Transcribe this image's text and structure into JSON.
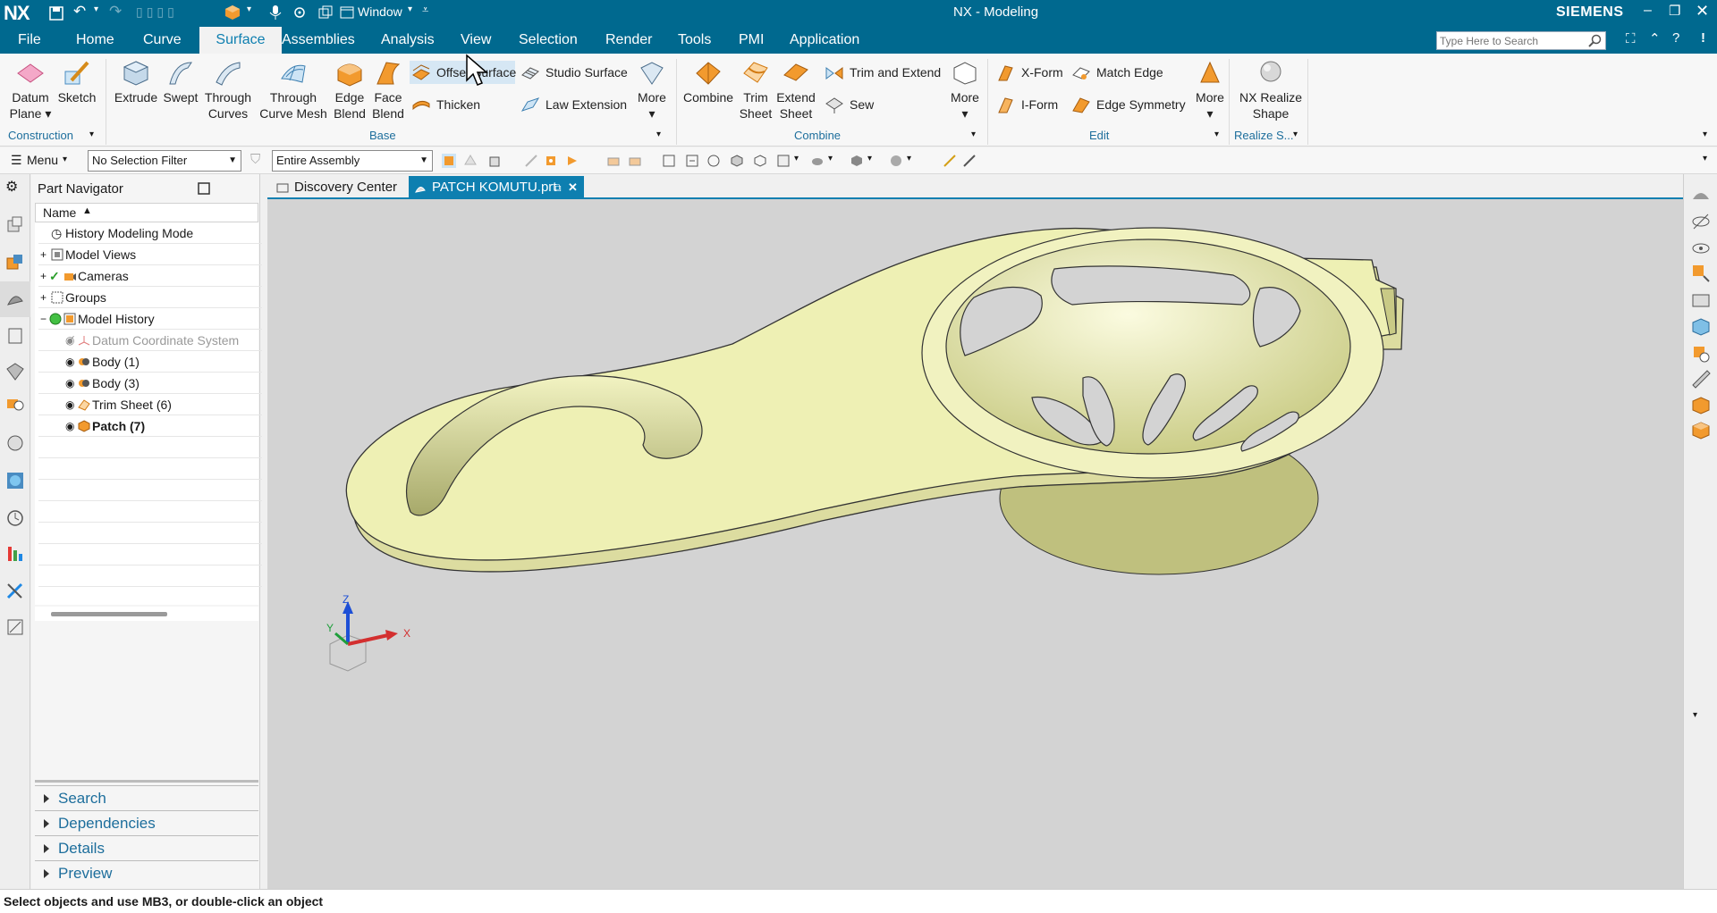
{
  "app": {
    "logo": "NX",
    "window_menu": "Window",
    "title": "NX - Modeling",
    "brand": "SIEMENS"
  },
  "menubar": {
    "items": [
      "File",
      "Home",
      "Curve",
      "Surface",
      "Assemblies",
      "Analysis",
      "View",
      "Selection",
      "Render",
      "Tools",
      "PMI",
      "Application"
    ],
    "active": "Surface",
    "search_placeholder": "Type Here to Search"
  },
  "ribbon": {
    "construction": {
      "datum_plane_1": "Datum",
      "datum_plane_2": "Plane",
      "sketch": "Sketch",
      "group": "Construction"
    },
    "base": {
      "extrude": "Extrude",
      "swept": "Swept",
      "through_curves_1": "Through",
      "through_curves_2": "Curves",
      "through_curve_mesh_1": "Through",
      "through_curve_mesh_2": "Curve Mesh",
      "edge_blend_1": "Edge",
      "edge_blend_2": "Blend",
      "face_blend_1": "Face",
      "face_blend_2": "Blend",
      "offset_surface": "Offset Surface",
      "thicken": "Thicken",
      "studio_surface": "Studio Surface",
      "law_extension": "Law Extension",
      "more": "More",
      "group": "Base"
    },
    "combine": {
      "combine": "Combine",
      "trim_sheet_1": "Trim",
      "trim_sheet_2": "Sheet",
      "extend_sheet_1": "Extend",
      "extend_sheet_2": "Sheet",
      "trim_and_extend": "Trim and Extend",
      "sew": "Sew",
      "more": "More",
      "group": "Combine"
    },
    "edit": {
      "x_form": "X-Form",
      "i_form": "I-Form",
      "match_edge": "Match Edge",
      "edge_symmetry": "Edge Symmetry",
      "more": "More",
      "group": "Edit"
    },
    "realize": {
      "nx_realize_shape_1": "NX Realize",
      "nx_realize_shape_2": "Shape",
      "group": "Realize S..."
    }
  },
  "toolbar": {
    "menu_label": "Menu",
    "selection_filter": "No Selection Filter",
    "scope": "Entire Assembly"
  },
  "navigator": {
    "title": "Part Navigator",
    "column_header": "Name",
    "rows": [
      {
        "label": "History Modeling Mode"
      },
      {
        "label": "Model Views"
      },
      {
        "label": "Cameras"
      },
      {
        "label": "Groups"
      },
      {
        "label": "Model History"
      },
      {
        "label": "Datum Coordinate System"
      },
      {
        "label": "Body (1)"
      },
      {
        "label": "Body (3)"
      },
      {
        "label": "Trim Sheet (6)"
      },
      {
        "label": "Patch (7)"
      }
    ],
    "panels": [
      "Search",
      "Dependencies",
      "Details",
      "Preview"
    ]
  },
  "tabs": [
    {
      "label": "Discovery Center"
    },
    {
      "label": "PATCH KOMUTU.prt"
    }
  ],
  "triad": {
    "x": "X",
    "y": "Y",
    "z": "Z"
  },
  "status": {
    "message": "Select objects and use MB3, or double-click an object"
  },
  "colors": {
    "accent": "#00698f",
    "model": "#eef0b4",
    "viewport": "#d3d3d3"
  }
}
